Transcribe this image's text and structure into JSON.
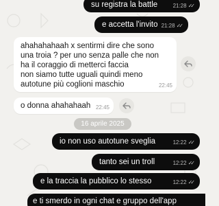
{
  "messages": [
    {
      "direction": "outgoing",
      "text": "su registra la battle",
      "time": "21:28",
      "status": "read"
    },
    {
      "direction": "outgoing",
      "text": "e accetta l'invito",
      "time": "21:28",
      "status": "read"
    },
    {
      "direction": "incoming",
      "lines": [
        "ahahahahaah x sentirmi dire che sono",
        "una troia ? per uno senza palle che non",
        "ha il coraggio di metterci faccia",
        "non siamo tutte uguali quindi meno",
        "autotune più coglioni maschio"
      ],
      "time": "22:45"
    },
    {
      "direction": "incoming",
      "text": "o donna ahahahaah",
      "time": "22:45"
    },
    {
      "direction": "outgoing",
      "text": "io non uso autotune sveglia",
      "time": "12:22",
      "status": "read"
    },
    {
      "direction": "outgoing",
      "text": "tanto sei un troll",
      "time": "12:22",
      "status": "read"
    },
    {
      "direction": "outgoing",
      "text": "e la traccia la pubblico lo stesso",
      "time": "12:22",
      "status": "read"
    },
    {
      "direction": "outgoing",
      "text": "e ti smerdo in ogni chat e gruppo dell'app",
      "time": "",
      "status": ""
    }
  ],
  "date_separator": "16 aprile 2025",
  "icons": {
    "reply": "reply-arrow-icon",
    "read_receipt": "double-check-icon"
  },
  "colors": {
    "background": "#f2f1ee",
    "outgoing_bubble": "#0d0d0d",
    "incoming_bubble": "#ffffff",
    "date_chip": "#c9c8c4"
  }
}
